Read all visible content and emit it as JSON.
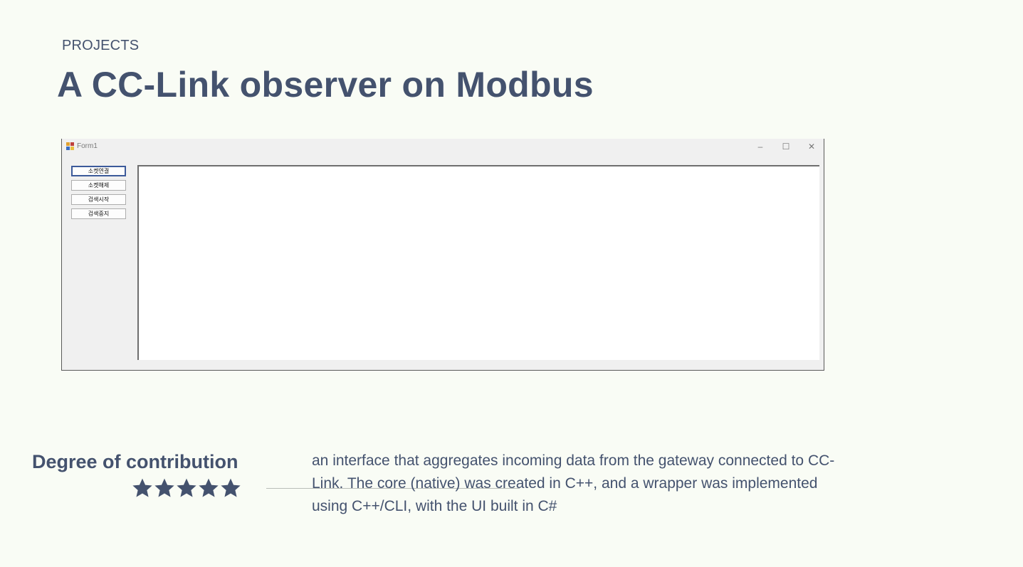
{
  "section": "PROJECTS",
  "title": "A CC-Link observer on Modbus",
  "form": {
    "window_title": "Form1",
    "icon": "form-app-icon",
    "controls": {
      "minimize": "–",
      "maximize": "☐",
      "close": "✕"
    },
    "buttons": [
      "소켓연결",
      "소켓해제",
      "검색시작",
      "검색중지"
    ],
    "focused_button_index": 0
  },
  "contribution": {
    "label": "Degree of contribution",
    "rating": 5,
    "max_rating": 5,
    "icon": "star-icon",
    "star_color": "#44526e"
  },
  "description": "an interface that aggregates incoming data from the gateway connected to CC-Link. The core (native) was created in C++, and a wrapper was implemented using C++/CLI, with the UI built in C#",
  "colors": {
    "background": "#f9fcf5",
    "text": "#44526e"
  }
}
